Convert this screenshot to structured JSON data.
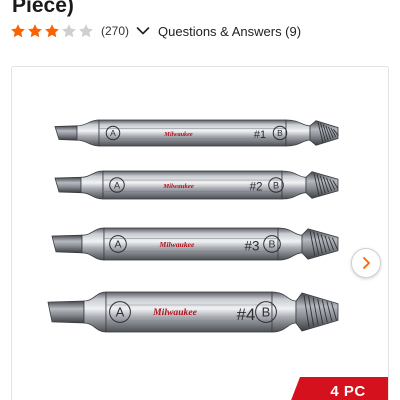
{
  "header": {
    "title_tail": "Piece)"
  },
  "rating": {
    "stars": 3,
    "max_stars": 5,
    "filled_color": "#f96302",
    "empty_color": "#cfcfcf",
    "review_count": "(270)",
    "qa_link": "Questions & Answers (9)"
  },
  "gallery": {
    "bits": [
      {
        "brand": "Milwaukee",
        "left_mark": "A",
        "number": "#1",
        "right_mark": "B"
      },
      {
        "brand": "Milwaukee",
        "left_mark": "A",
        "number": "#2",
        "right_mark": "B"
      },
      {
        "brand": "Milwaukee",
        "left_mark": "A",
        "number": "#3",
        "right_mark": "B"
      },
      {
        "brand": "Milwaukee",
        "left_mark": "A",
        "number": "#4",
        "right_mark": "B"
      }
    ],
    "next_icon": "chevron-right-icon",
    "badge": "4 PC",
    "badge_color": "#d6111e"
  }
}
